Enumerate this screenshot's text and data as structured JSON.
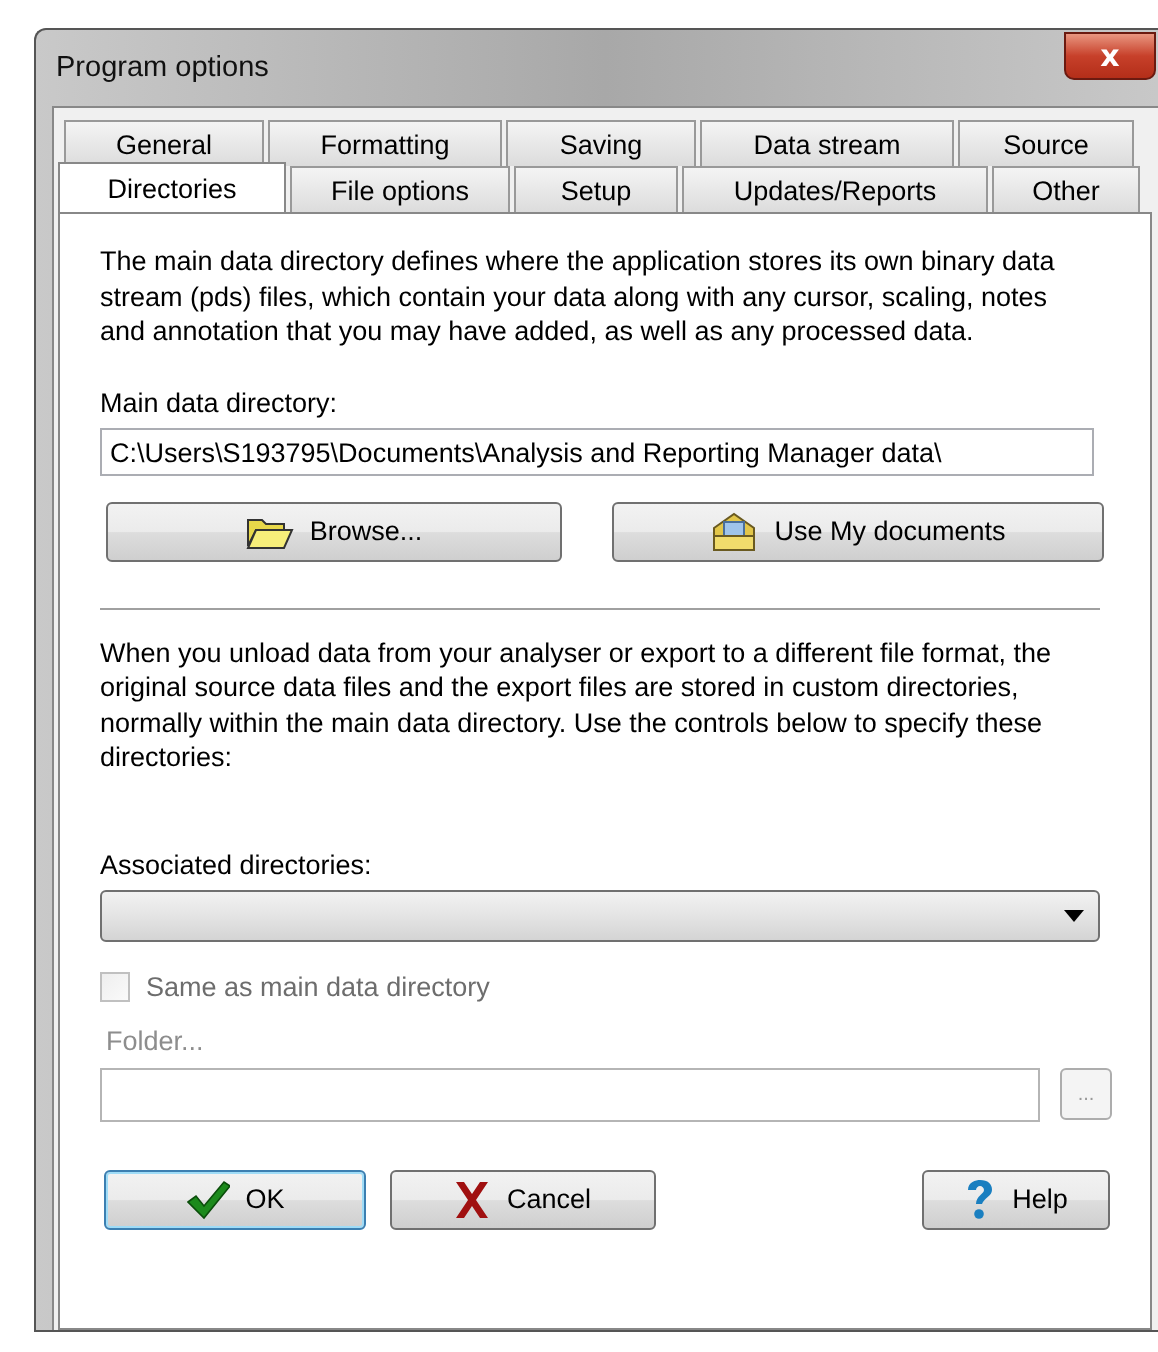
{
  "window": {
    "title": "Program options",
    "close_label": "x"
  },
  "tab_rows": [
    [
      {
        "label": "General",
        "selected": false
      },
      {
        "label": "Formatting",
        "selected": false
      },
      {
        "label": "Saving",
        "selected": false
      },
      {
        "label": "Data stream",
        "selected": false
      },
      {
        "label": "Source",
        "selected": false
      }
    ],
    [
      {
        "label": "Directories",
        "selected": true
      },
      {
        "label": "File options",
        "selected": false
      },
      {
        "label": "Setup",
        "selected": false
      },
      {
        "label": "Updates/Reports",
        "selected": false
      },
      {
        "label": "Other",
        "selected": false
      }
    ]
  ],
  "intro": "The main data directory defines where the application stores its own binary data stream (pds) files, which contain your data along with any cursor, scaling, notes and annotation  that you may have added, as well as any processed data.",
  "main_dir": {
    "label": "Main data directory:",
    "value": "C:\\Users\\S193795\\Documents\\Analysis and Reporting Manager data\\"
  },
  "dir_buttons": [
    {
      "label": "Browse...",
      "kind": "browse"
    },
    {
      "label": "Use My documents",
      "kind": "docs"
    }
  ],
  "associated_intro": "When you unload data from your analyser or export to a different file format, the original source data files and the export files are stored in custom directories, normally within the main data directory.  Use the controls below to specify these directories:",
  "associated": {
    "label": "Associated directories:"
  },
  "same_as_main": {
    "label": "Same as main data directory",
    "checked": false,
    "disabled": true
  },
  "folder": {
    "label": "Folder...",
    "disabled": true,
    "browse_label": "..."
  },
  "footer_buttons": [
    {
      "label": "OK",
      "kind": "ok",
      "default": true
    },
    {
      "label": "Cancel",
      "kind": "cancel",
      "default": false
    },
    {
      "label": "Help",
      "kind": "help",
      "default": false
    }
  ]
}
